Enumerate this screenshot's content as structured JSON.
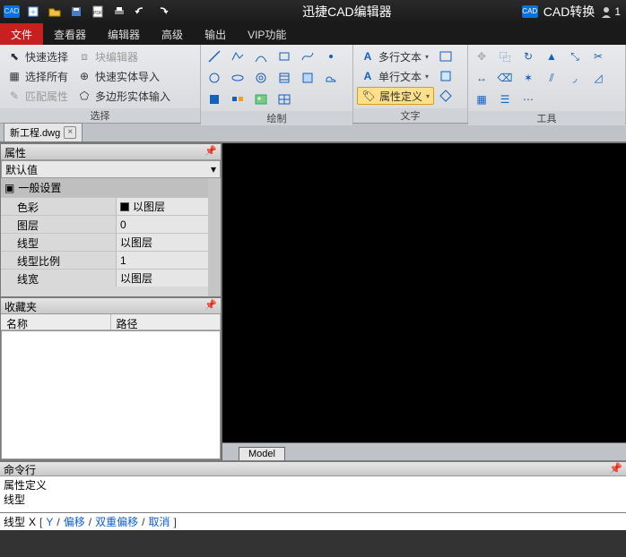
{
  "app": {
    "title": "迅捷CAD编辑器",
    "cad_convert": "CAD转换",
    "user_count": "1"
  },
  "menu": {
    "items": [
      "文件",
      "查看器",
      "编辑器",
      "高级",
      "输出",
      "VIP功能"
    ],
    "active_index": 0
  },
  "ribbon": {
    "select": {
      "label": "选择",
      "quick_select": "快速选择",
      "select_all": "选择所有",
      "match_props": "匹配属性",
      "block_editor": "块编辑器",
      "quick_entity_import": "快速实体导入",
      "polygon_entity_input": "多边形实体输入"
    },
    "draw": {
      "label": "绘制"
    },
    "text": {
      "label": "文字",
      "mtext": "多行文本",
      "stext": "单行文本",
      "attdef": "属性定义"
    },
    "tools": {
      "label": "工具"
    }
  },
  "doc_tab": {
    "name": "新工程.dwg"
  },
  "props": {
    "panel_title": "属性",
    "default_combo": "默认值",
    "section": "一般设置",
    "rows": [
      {
        "k": "色彩",
        "v": "以图层",
        "swatch": true
      },
      {
        "k": "图层",
        "v": "0"
      },
      {
        "k": "线型",
        "v": "以图层"
      },
      {
        "k": "线型比例",
        "v": "1"
      },
      {
        "k": "线宽",
        "v": "以图层"
      }
    ]
  },
  "fav": {
    "panel_title": "收藏夹",
    "col_name": "名称",
    "col_path": "路径"
  },
  "canvas": {
    "model_tab": "Model"
  },
  "cmd": {
    "panel_title": "命令行",
    "lines": [
      "属性定义",
      "线型"
    ],
    "prompt_prefix": "线型",
    "prompt_parts": [
      "X",
      "[",
      "Y",
      "/",
      "偏移",
      "/",
      "双重偏移",
      "/",
      "取消",
      "]"
    ]
  }
}
